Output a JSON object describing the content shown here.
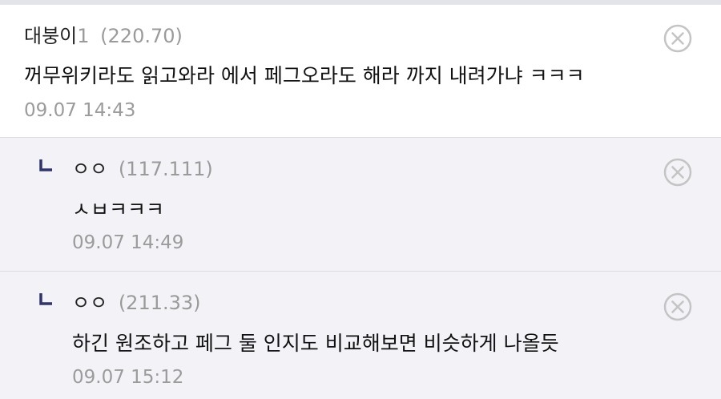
{
  "colors": {
    "top_strip": "#e3e3ea",
    "reply_background": "#f3f3f7",
    "main_background": "#ffffff",
    "reply_arrow": "#2f3470",
    "meta_gray": "#9a9a9a",
    "delete_icon": "#c4c4c4"
  },
  "comments": [
    {
      "author": "대붕이",
      "author_suffix": "1",
      "ip": "(220.70)",
      "text": "꺼무위키라도 읽고와라 에서 페그오라도 해라 까지 내려가냐 ㅋㅋㅋ",
      "timestamp": "09.07 14:43",
      "delete_icon": "circle-x-icon"
    },
    {
      "author": "ㅇㅇ",
      "ip": "(117.111)",
      "text": "ㅅㅂㅋㅋㅋ",
      "timestamp": "09.07 14:49",
      "reply_icon": "reply-arrow-icon",
      "delete_icon": "circle-x-icon"
    },
    {
      "author": "ㅇㅇ",
      "ip": "(211.33)",
      "text": "하긴 원조하고 페그 둘 인지도 비교해보면 비슷하게 나올듯",
      "timestamp": "09.07 15:12",
      "reply_icon": "reply-arrow-icon",
      "delete_icon": "circle-x-icon"
    }
  ]
}
